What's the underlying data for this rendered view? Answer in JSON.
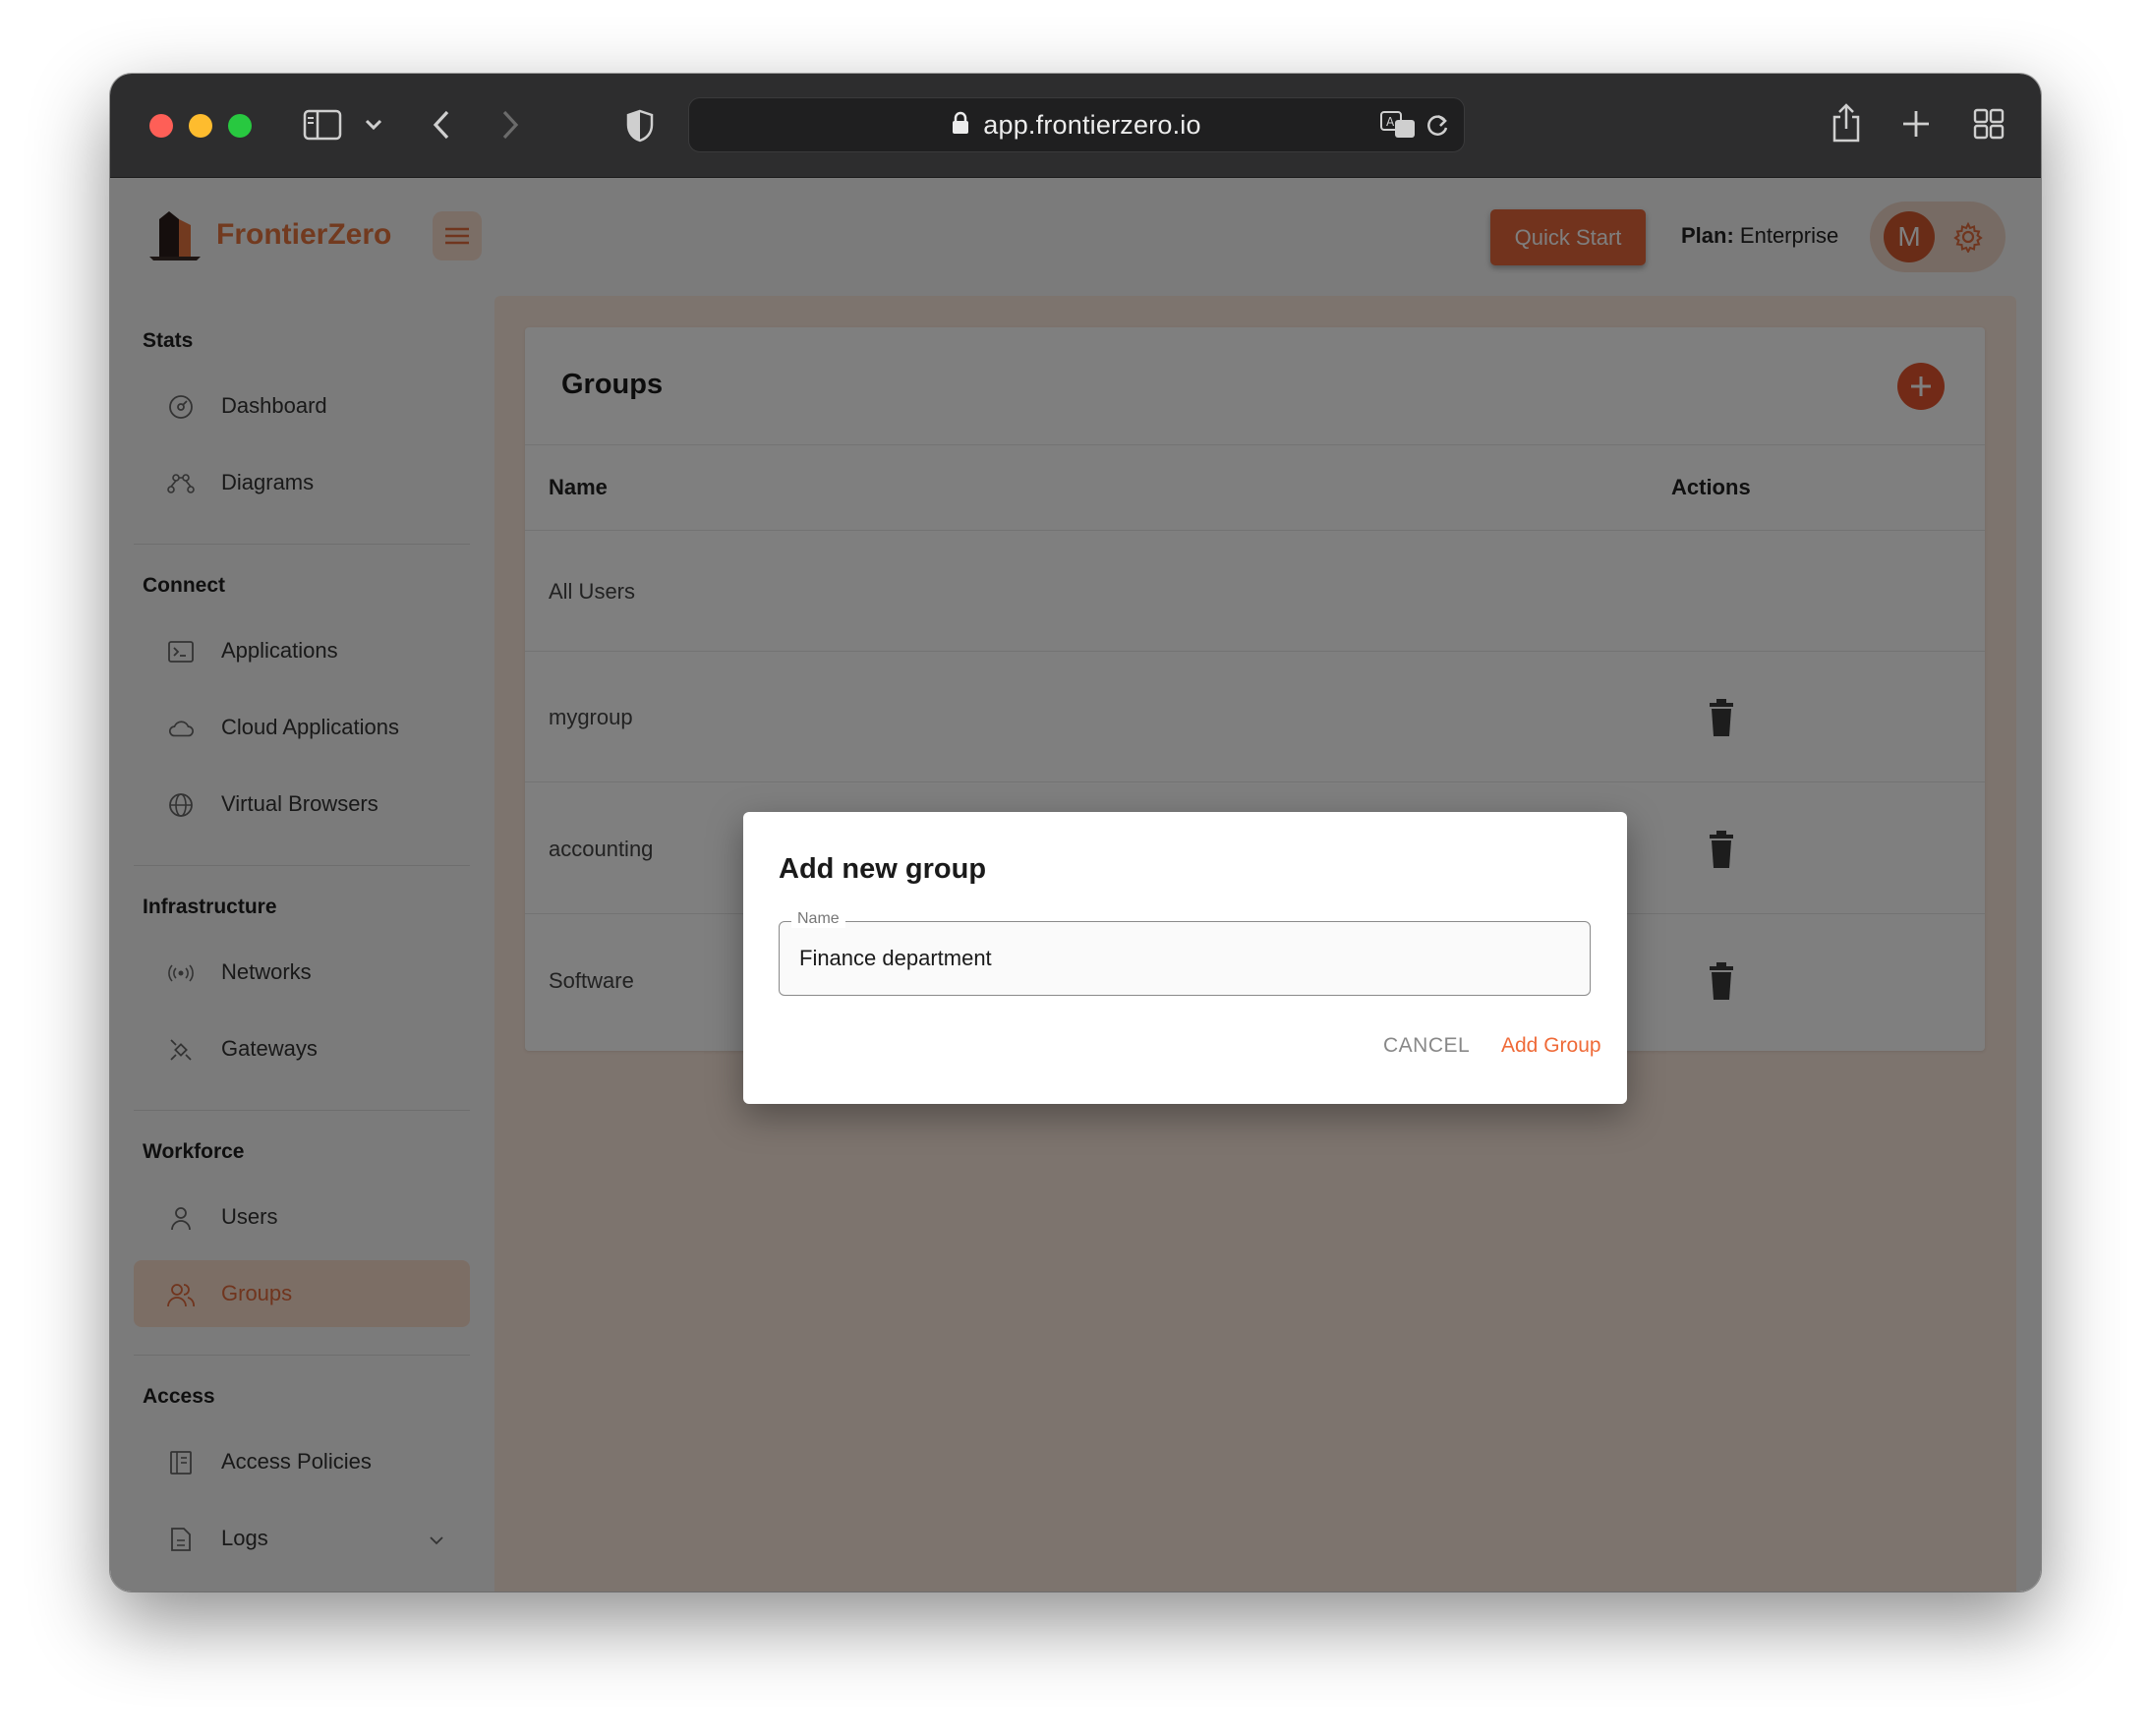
{
  "browser": {
    "url": "app.frontierzero.io"
  },
  "app": {
    "brand": "FrontierZero",
    "quick_start_label": "Quick Start",
    "plan_label": "Plan:",
    "plan_value": "Enterprise",
    "avatar_initial": "M"
  },
  "sidebar": {
    "sections": [
      {
        "title": "Stats",
        "items": [
          {
            "label": "Dashboard",
            "icon": "dashboard-icon"
          },
          {
            "label": "Diagrams",
            "icon": "diagrams-icon"
          }
        ]
      },
      {
        "title": "Connect",
        "items": [
          {
            "label": "Applications",
            "icon": "terminal-icon"
          },
          {
            "label": "Cloud Applications",
            "icon": "cloud-icon"
          },
          {
            "label": "Virtual Browsers",
            "icon": "globe-icon"
          }
        ]
      },
      {
        "title": "Infrastructure",
        "items": [
          {
            "label": "Networks",
            "icon": "broadcast-icon"
          },
          {
            "label": "Gateways",
            "icon": "satellite-icon"
          }
        ]
      },
      {
        "title": "Workforce",
        "items": [
          {
            "label": "Users",
            "icon": "user-icon"
          },
          {
            "label": "Groups",
            "icon": "users-icon",
            "active": true
          }
        ]
      },
      {
        "title": "Access",
        "items": [
          {
            "label": "Access Policies",
            "icon": "policy-icon"
          },
          {
            "label": "Logs",
            "icon": "file-icon"
          }
        ]
      }
    ]
  },
  "groups": {
    "title": "Groups",
    "columns": [
      "Name",
      "Actions"
    ],
    "rows": [
      {
        "name": "All Users"
      },
      {
        "name": "mygroup"
      },
      {
        "name": "accounting"
      },
      {
        "name": "Software"
      }
    ]
  },
  "dialog": {
    "title": "Add new group",
    "field_label": "Name",
    "field_value": "Finance department",
    "cancel_label": "CANCEL",
    "submit_label": "Add Group"
  },
  "colors": {
    "accent": "#e4663a",
    "accent_light": "#f9dccb"
  }
}
